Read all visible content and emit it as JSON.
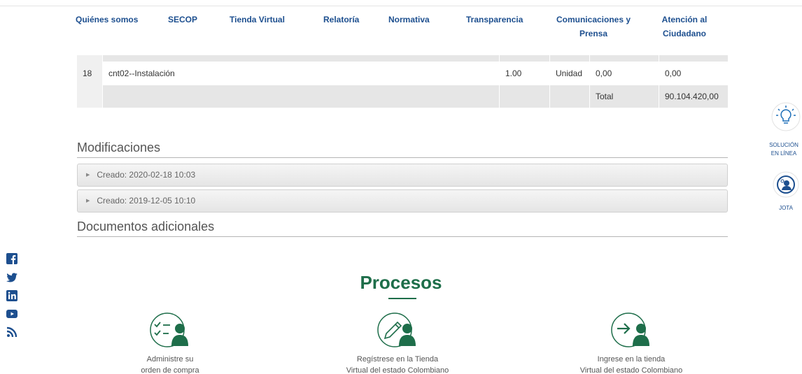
{
  "nav": {
    "items": [
      {
        "label": "Quiénes somos"
      },
      {
        "label": "SECOP"
      },
      {
        "label": "Tienda Virtual"
      },
      {
        "label": "Relatoría"
      },
      {
        "label": "Normativa"
      },
      {
        "label": "Transparencia"
      },
      {
        "label": "Comunicaciones y",
        "label2": "Prensa"
      },
      {
        "label": "Atención al",
        "label2": "Ciudadano"
      }
    ]
  },
  "table": {
    "row": {
      "num": "18",
      "description": "cnt02--Instalación",
      "quantity": "1.00",
      "unit": "Unidad",
      "unit_price": "0,00",
      "total": "0,00"
    },
    "total_label": "Total",
    "total_value": "90.104.420,00"
  },
  "modificaciones": {
    "title": "Modificaciones",
    "items": [
      {
        "label": "Creado: 2020-02-18 10:03"
      },
      {
        "label": "Creado: 2019-12-05 10:10"
      }
    ]
  },
  "documentos": {
    "title": "Documentos adicionales"
  },
  "procesos": {
    "title": "Procesos",
    "items": [
      {
        "line1": "Administre su",
        "line2": "orden de compra"
      },
      {
        "line1": "Regístrese en la Tienda",
        "line2": "Virtual del estado Colombiano"
      },
      {
        "line1": "Ingrese en la tienda",
        "line2": "Virtual del estado Colombiano"
      }
    ]
  },
  "widgets": {
    "solucion_line1": "SOLUCIÓN",
    "solucion_line2": "EN LÍNEA",
    "jota": "JOTA"
  },
  "colors": {
    "nav": "#1d4f8f",
    "brand_green": "#1e6e4a",
    "grey_row": "#e6e6e6"
  },
  "social_icons": [
    "facebook-icon",
    "twitter-icon",
    "linkedin-icon",
    "youtube-icon",
    "rss-icon"
  ]
}
